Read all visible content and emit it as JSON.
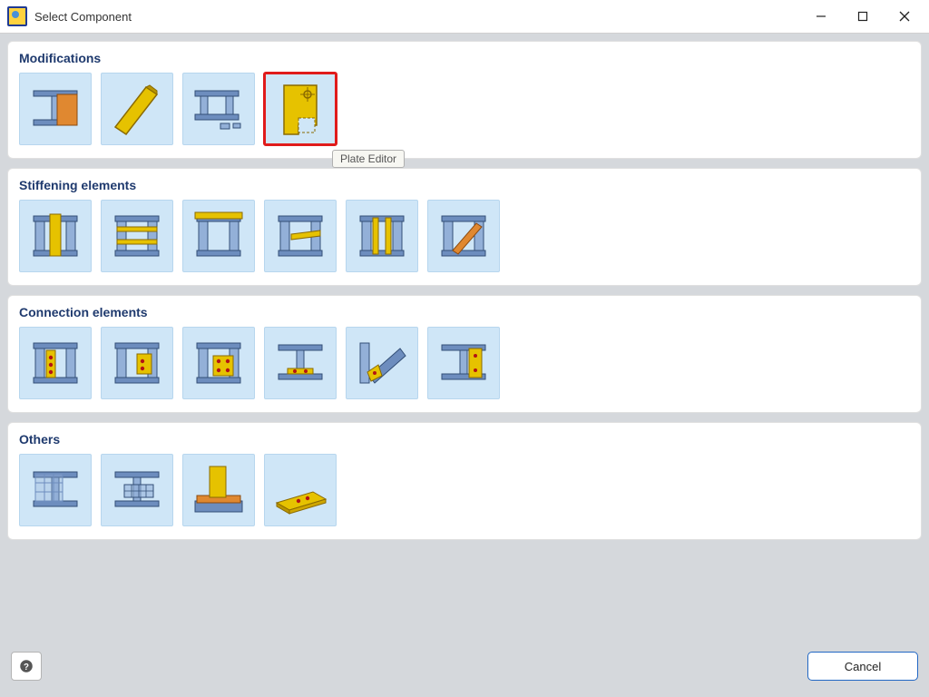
{
  "window": {
    "title": "Select Component",
    "window_controls": [
      "minimize",
      "maximize",
      "close"
    ]
  },
  "panels": [
    {
      "title": "Modifications",
      "tiles": [
        {
          "name": "beam-section-mod",
          "icon": "beam-section",
          "selected": false
        },
        {
          "name": "plate-mod",
          "icon": "plate",
          "selected": false
        },
        {
          "name": "beam-assembly-mod",
          "icon": "beam-assembly",
          "selected": false
        },
        {
          "name": "plate-editor",
          "icon": "plate-editor",
          "selected": true,
          "tooltip": "Plate Editor"
        }
      ]
    },
    {
      "title": "Stiffening elements",
      "tiles": [
        {
          "name": "stiffener-web",
          "icon": "frame-center-panel"
        },
        {
          "name": "stiffener-horizontal",
          "icon": "frame-horizontal-bars"
        },
        {
          "name": "stiffener-cap",
          "icon": "frame-top-cap"
        },
        {
          "name": "stiffener-mid-shelf",
          "icon": "frame-mid-shelf"
        },
        {
          "name": "stiffener-double",
          "icon": "frame-double"
        },
        {
          "name": "stiffener-brace",
          "icon": "frame-brace"
        }
      ]
    },
    {
      "title": "Connection elements",
      "tiles": [
        {
          "name": "conn-end-plate",
          "icon": "column-plate"
        },
        {
          "name": "conn-flange-plate",
          "icon": "column-plate-side"
        },
        {
          "name": "conn-double-plate",
          "icon": "column-plate-square"
        },
        {
          "name": "conn-seated",
          "icon": "beam-on-seat"
        },
        {
          "name": "conn-brace",
          "icon": "diagonal-brace"
        },
        {
          "name": "conn-splice",
          "icon": "beam-splice"
        }
      ]
    },
    {
      "title": "Others",
      "tiles": [
        {
          "name": "other-grid",
          "icon": "grid-panel"
        },
        {
          "name": "other-block",
          "icon": "beam-block"
        },
        {
          "name": "other-anchor",
          "icon": "anchor-block"
        },
        {
          "name": "other-base-plate",
          "icon": "base-plate"
        }
      ]
    }
  ],
  "footer": {
    "help_aria": "Help",
    "cancel_label": "Cancel"
  },
  "colors": {
    "tile_bg": "#cfe6f7",
    "steel": "#6d8dbe",
    "steel_light": "#93b0d8",
    "gold": "#e6c200",
    "gold_dark": "#b89400",
    "orange": "#e08830",
    "red_dot": "#b31414",
    "outline": "#334f77"
  }
}
